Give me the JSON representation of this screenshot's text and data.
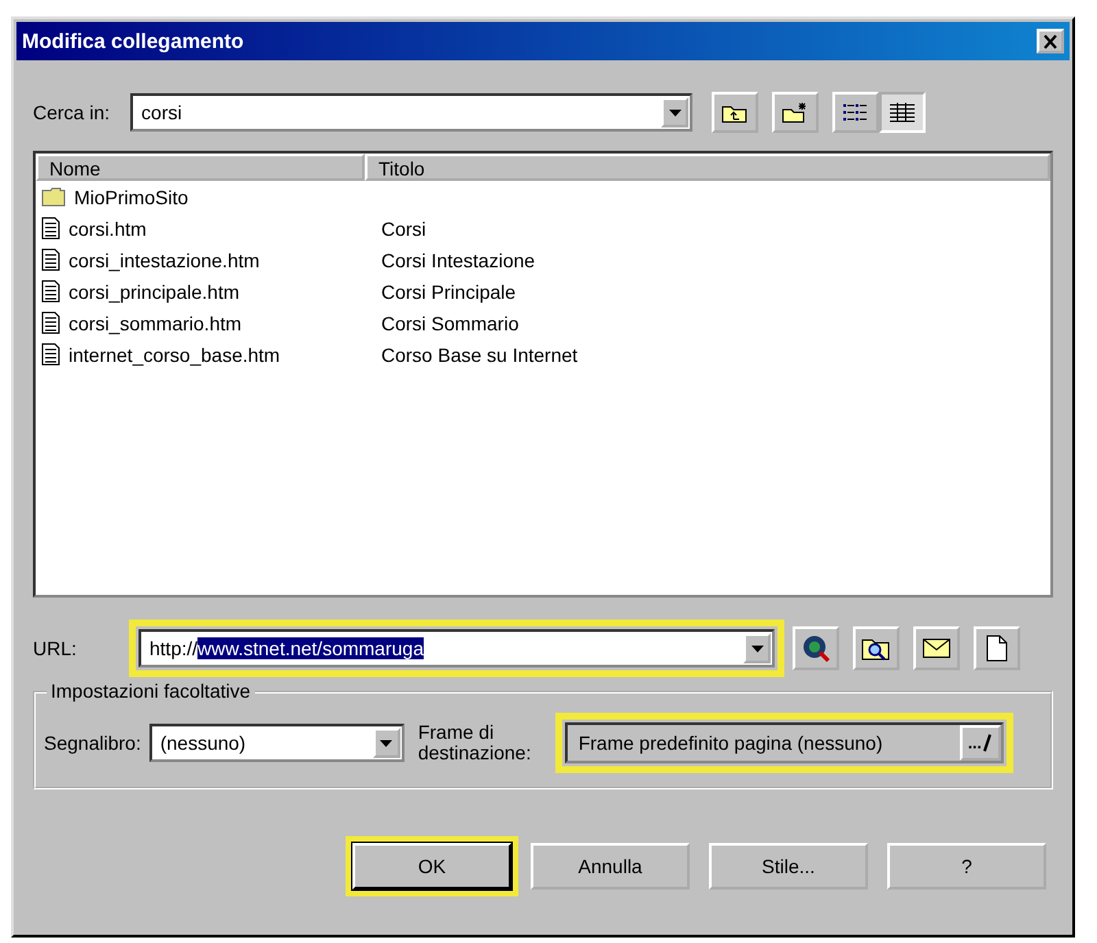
{
  "window": {
    "title": "Modifica collegamento"
  },
  "look_in": {
    "label": "Cerca in:",
    "value": "corsi"
  },
  "toolbar": [
    {
      "kind": "up-folder"
    },
    {
      "kind": "new-folder"
    },
    {
      "kind": "list-view",
      "selected": false
    },
    {
      "kind": "details-view",
      "selected": true
    }
  ],
  "file_list": {
    "columns": [
      "Nome",
      "Titolo"
    ],
    "rows": [
      {
        "kind": "folder",
        "name": "MioPrimoSito"
      },
      {
        "kind": "file",
        "name": "corsi.htm",
        "title": "Corsi"
      },
      {
        "kind": "file",
        "name": "corsi_intestazione.htm",
        "title": "Corsi Intestazione"
      },
      {
        "kind": "file",
        "name": "corsi_principale.htm",
        "title": "Corsi Principale"
      },
      {
        "kind": "file",
        "name": "corsi_sommario.htm",
        "title": "Corsi Sommario"
      },
      {
        "kind": "file",
        "name": "internet_corso_base.htm",
        "title": "Corso Base su Internet"
      }
    ]
  },
  "url": {
    "label": "URL:",
    "value": "http://",
    "selected_text": "www.stnet.net/sommaruga",
    "highlighted": true
  },
  "url_buttons": [
    {
      "kind": "browse-web"
    },
    {
      "kind": "browse-file"
    },
    {
      "kind": "email"
    },
    {
      "kind": "new-page"
    }
  ],
  "options": {
    "title": "Impostazioni facoltative",
    "bookmark_label": "Segnalibro:",
    "bookmark_value": "(nessuno)",
    "frame_label": "Frame di destinazione:",
    "frame_value": "Frame predefinito pagina (nessuno)",
    "frame_button": "...",
    "frame_highlighted": true
  },
  "buttons": [
    {
      "label": "OK",
      "default": true,
      "highlighted": true
    },
    {
      "label": "Annulla",
      "default": false,
      "highlighted": false
    },
    {
      "label": "Stile...",
      "default": false,
      "highlighted": false
    },
    {
      "label": "?",
      "default": false,
      "highlighted": false
    }
  ]
}
